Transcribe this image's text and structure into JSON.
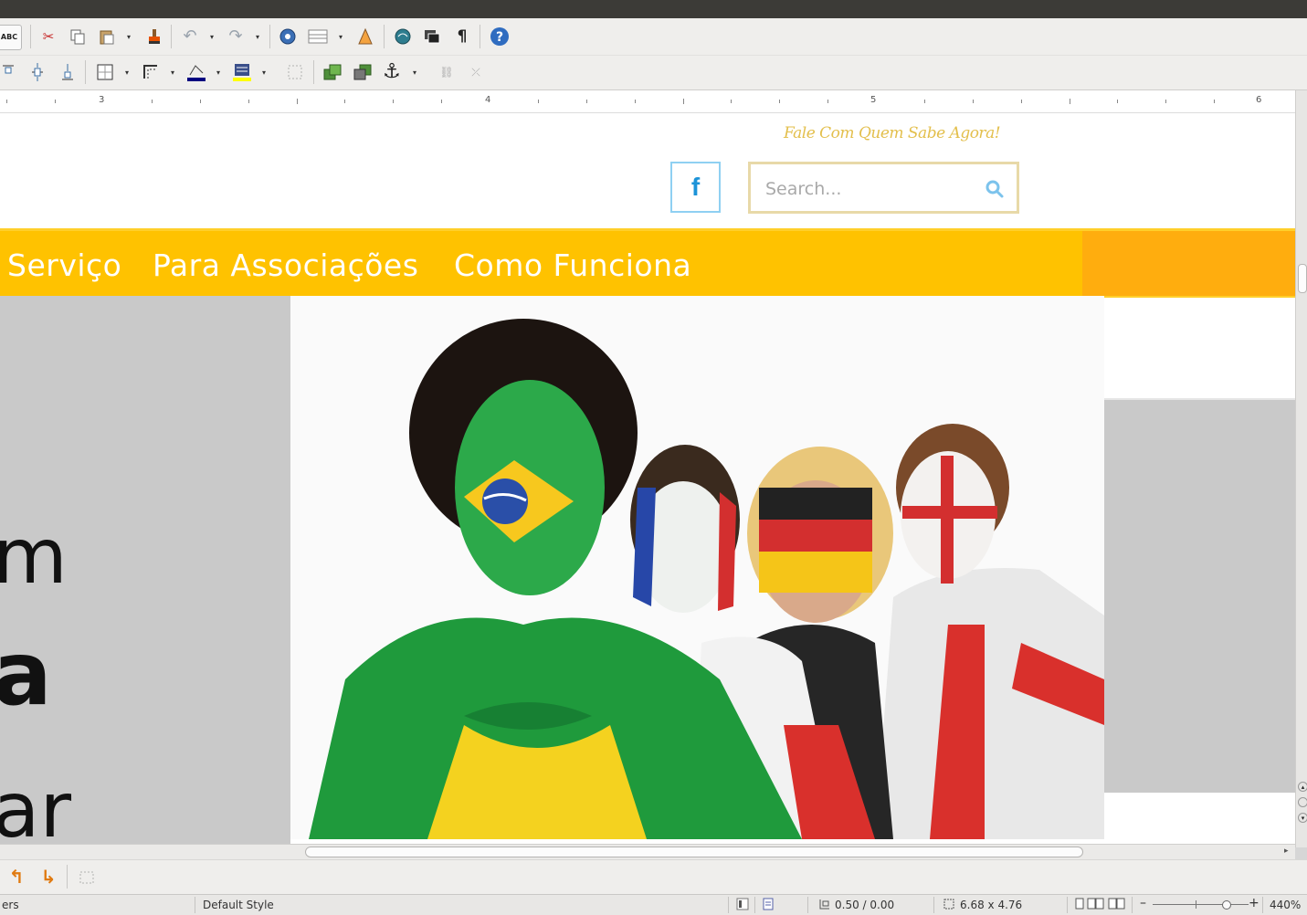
{
  "toolbar_standard": {
    "icons": [
      "spellcheck-icon",
      "cut-icon",
      "copy-icon",
      "paste-icon",
      "clone-formatting-icon",
      "undo-icon",
      "redo-icon",
      "navigator-icon",
      "table-icon",
      "draw-functions-icon",
      "gallery-icon",
      "data-sources-icon",
      "formatting-marks-icon",
      "help-icon"
    ]
  },
  "toolbar_frame": {
    "icons": [
      "align-top-icon",
      "align-center-icon",
      "align-bottom-icon",
      "borders-icon",
      "border-style-icon",
      "line-color-icon",
      "background-color-icon",
      "frame-properties-icon",
      "bring-to-front-icon",
      "send-to-back-icon",
      "anchor-icon",
      "link-frames-icon",
      "unlink-frames-icon"
    ],
    "colors": {
      "line_color": "#000080",
      "background_color": "#ffff00"
    }
  },
  "ruler": {
    "labels": [
      "3",
      "4",
      "5",
      "6"
    ]
  },
  "page": {
    "tagline": "Fale Com Quem Sabe Agora!",
    "facebook_glyph": "f",
    "search": {
      "placeholder": "Search..."
    },
    "nav": [
      "Serviço",
      "Para Associações",
      "Como Funciona"
    ],
    "partial_text": [
      "m",
      "a",
      "ar"
    ],
    "colors": {
      "nav_bg": "#ffc200",
      "nav_right_bg": "#ffad0e",
      "tagline": "#e3bf4c",
      "facebook": "#1c93d8"
    }
  },
  "bottom_toolbar": {
    "icons": [
      "rotate-left-icon",
      "rotate-right-icon",
      "frame-icon"
    ]
  },
  "status_bar": {
    "word_count_partial": "ers",
    "page_style": "Default Style",
    "position": "0.50 / 0.00",
    "size": "6.68 x 4.76",
    "zoom": "440%"
  }
}
